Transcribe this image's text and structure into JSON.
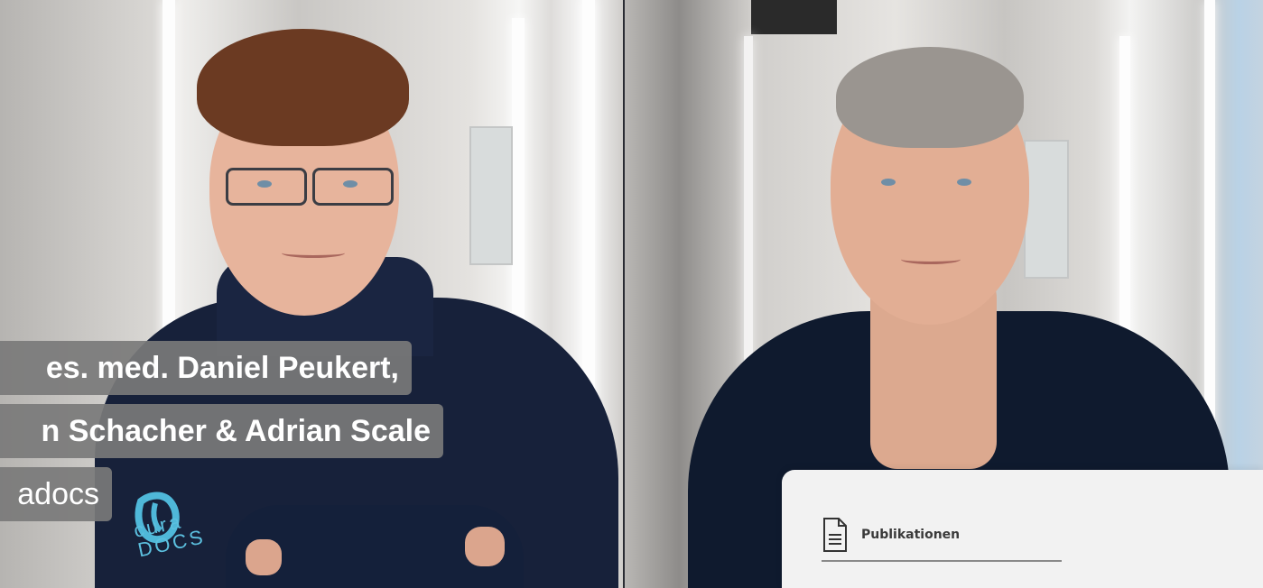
{
  "caption": {
    "line1": "es. med. Daniel Peukert,",
    "line2": "n Schacher & Adrian Scale",
    "line3": "adocs"
  },
  "logo": {
    "text_top": "cura",
    "text_bottom": "DOCS",
    "icon": "curadocs-logo-icon",
    "color": "#4fb8d9"
  },
  "publication_card": {
    "items": [
      {
        "label": "Publikationen",
        "icon": "document-icon"
      }
    ]
  },
  "colors": {
    "jacket": "#17213a",
    "caption_bg": "#7a7a7a",
    "card_bg": "#f2f2f2"
  }
}
